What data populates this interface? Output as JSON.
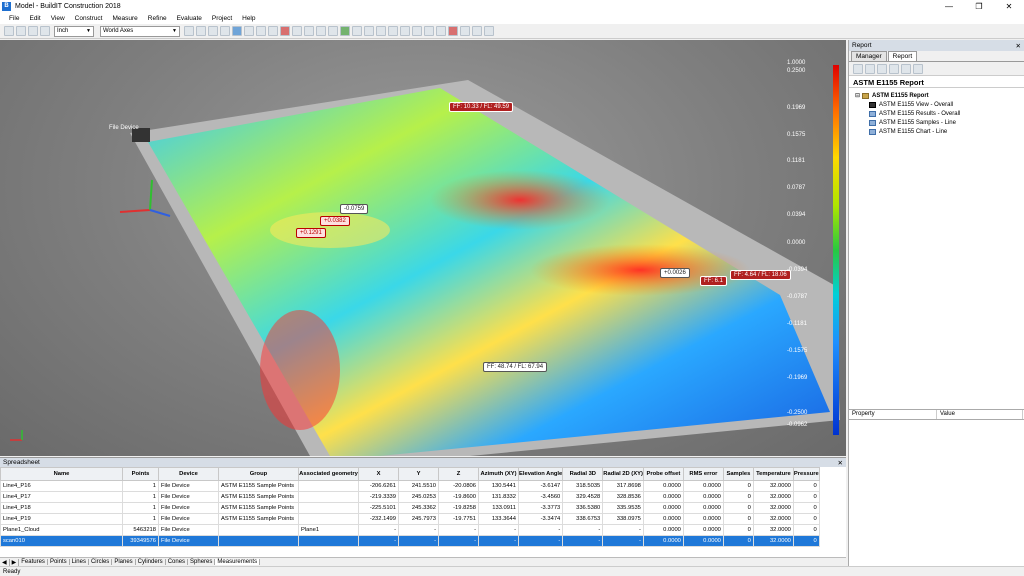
{
  "app": {
    "title": "Model - BuildIT Construction 2018",
    "icon_name": "buildit-app-icon"
  },
  "menu": [
    "File",
    "Edit",
    "View",
    "Construct",
    "Measure",
    "Refine",
    "Evaluate",
    "Project",
    "Help"
  ],
  "toolbar": {
    "unit_value": "Inch",
    "axes_value": "World Axes"
  },
  "viewport": {
    "labels": [
      {
        "text": "FF: 10.33 / FL: 49.59",
        "style": "red"
      },
      {
        "text": "FF: 4.64 / FL: 18.06",
        "style": "red"
      },
      {
        "text": "FF: 6.1",
        "style": "red"
      },
      {
        "text": "FF: 48.74 / FL: 67.94",
        "style": "white"
      },
      {
        "text": "-0.0759",
        "style": "white"
      },
      {
        "text": "+0.0382",
        "style": "pink"
      },
      {
        "text": "+0.1291",
        "style": "pink"
      },
      {
        "text": "+0.0026",
        "style": "white"
      }
    ],
    "device_label": "File Device",
    "scale": [
      "1.0000",
      "0.2500",
      "0.1969",
      "0.1575",
      "0.1181",
      "0.0787",
      "0.0394",
      "0.0000",
      "-0.0394",
      "-0.0787",
      "-0.1181",
      "-0.1575",
      "-0.1969",
      "-0.2500",
      "-0.0962"
    ],
    "colors": {
      "high": "#e00000",
      "mid": "#28c840",
      "low": "#0033d0"
    }
  },
  "report": {
    "panel_title": "Report",
    "tabs": [
      "Manager",
      "Report"
    ],
    "title": "ASTM E1155 Report",
    "tree": [
      {
        "label": "ASTM E1155 Report",
        "level": 0,
        "icon": "folder-icon"
      },
      {
        "label": "ASTM E1155 View - Overall",
        "level": 1,
        "icon": "camera-icon"
      },
      {
        "label": "ASTM E1155 Results - Overall",
        "level": 1,
        "icon": "document-icon"
      },
      {
        "label": "ASTM E1155 Samples - Line",
        "level": 1,
        "icon": "document-icon"
      },
      {
        "label": "ASTM E1155 Chart - Line",
        "level": 1,
        "icon": "document-icon"
      }
    ],
    "property_headers": [
      "Property",
      "Value"
    ]
  },
  "spreadsheet": {
    "title": "Spreadsheet",
    "columns": [
      "Name",
      "Points",
      "Device",
      "Group",
      "Associated geometry",
      "X",
      "Y",
      "Z",
      "Azimuth (XY)",
      "Elevation Angle",
      "Radial 3D",
      "Radial 2D (XY)",
      "Probe offset",
      "RMS error",
      "Samples",
      "Temperature",
      "Pressure"
    ],
    "rows": [
      [
        "Line4_P16",
        "1",
        "File Device",
        "ASTM E1155 Sample Points",
        "",
        "-206.6261",
        "241.5510",
        "-20.0806",
        "130.5441",
        "-3.6147",
        "318.5035",
        "317.8698",
        "0.0000",
        "0.0000",
        "0",
        "32.0000",
        "0"
      ],
      [
        "Line4_P17",
        "1",
        "File Device",
        "ASTM E1155 Sample Points",
        "",
        "-219.3339",
        "245.0253",
        "-19.8600",
        "131.8332",
        "-3.4560",
        "329.4528",
        "328.8536",
        "0.0000",
        "0.0000",
        "0",
        "32.0000",
        "0"
      ],
      [
        "Line4_P18",
        "1",
        "File Device",
        "ASTM E1155 Sample Points",
        "",
        "-225.5101",
        "245.3362",
        "-19.8258",
        "133.0911",
        "-3.3773",
        "336.5380",
        "335.9535",
        "0.0000",
        "0.0000",
        "0",
        "32.0000",
        "0"
      ],
      [
        "Line4_P19",
        "1",
        "File Device",
        "ASTM E1155 Sample Points",
        "",
        "-232.1499",
        "245.7973",
        "-19.7751",
        "133.3644",
        "-3.3474",
        "338.6753",
        "338.0975",
        "0.0000",
        "0.0000",
        "0",
        "32.0000",
        "0"
      ],
      [
        "Plane1_Cloud",
        "5463218",
        "File Device",
        "",
        "Plane1",
        "-",
        "-",
        "-",
        "-",
        "-",
        "-",
        "-",
        "0.0000",
        "0.0000",
        "0",
        "32.0000",
        "0"
      ],
      [
        "scan010",
        "39349576",
        "File Device",
        "",
        "",
        "-",
        "-",
        "-",
        "-",
        "-",
        "-",
        "-",
        "0.0000",
        "0.0000",
        "0",
        "32.0000",
        "0"
      ]
    ],
    "selected_row": 5,
    "tabs": [
      "Features",
      "Points",
      "Lines",
      "Circles",
      "Planes",
      "Cylinders",
      "Cones",
      "Spheres",
      "Measurements"
    ]
  },
  "status": "Ready"
}
